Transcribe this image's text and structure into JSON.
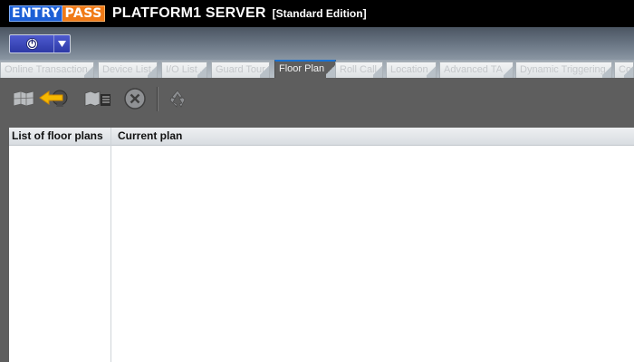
{
  "titlebar": {
    "logo_part1": "ENTRY",
    "logo_part2": "PASS",
    "title": "PLATFORM1 SERVER",
    "edition": "[Standard Edition]"
  },
  "tabs": [
    {
      "label": "Online Transaction",
      "active": false
    },
    {
      "label": "Device List",
      "active": false
    },
    {
      "label": "I/O List",
      "active": false
    },
    {
      "label": "Guard Tour",
      "active": false
    },
    {
      "label": "Floor Plan",
      "active": true
    },
    {
      "label": "Roll Call",
      "active": false
    },
    {
      "label": "Location",
      "active": false
    },
    {
      "label": "Advanced TA",
      "active": false
    },
    {
      "label": "Dynamic Triggering",
      "active": false
    },
    {
      "label": "Con",
      "active": false
    }
  ],
  "toolbar": {
    "icons": [
      "floor-map-icon",
      "back-arrow-icon",
      "floor-list-icon",
      "close-circle-icon",
      "refresh-icon"
    ],
    "accent": "#f5b800"
  },
  "panels": {
    "list_header": "List of floor plans",
    "main_header": "Current plan"
  },
  "colors": {
    "background": "#5e5e5e",
    "titlebar": "#000000",
    "active_tab_indicator": "#1a72d2",
    "logo_blue": "#1c5fd6",
    "logo_orange": "#f07a17"
  }
}
